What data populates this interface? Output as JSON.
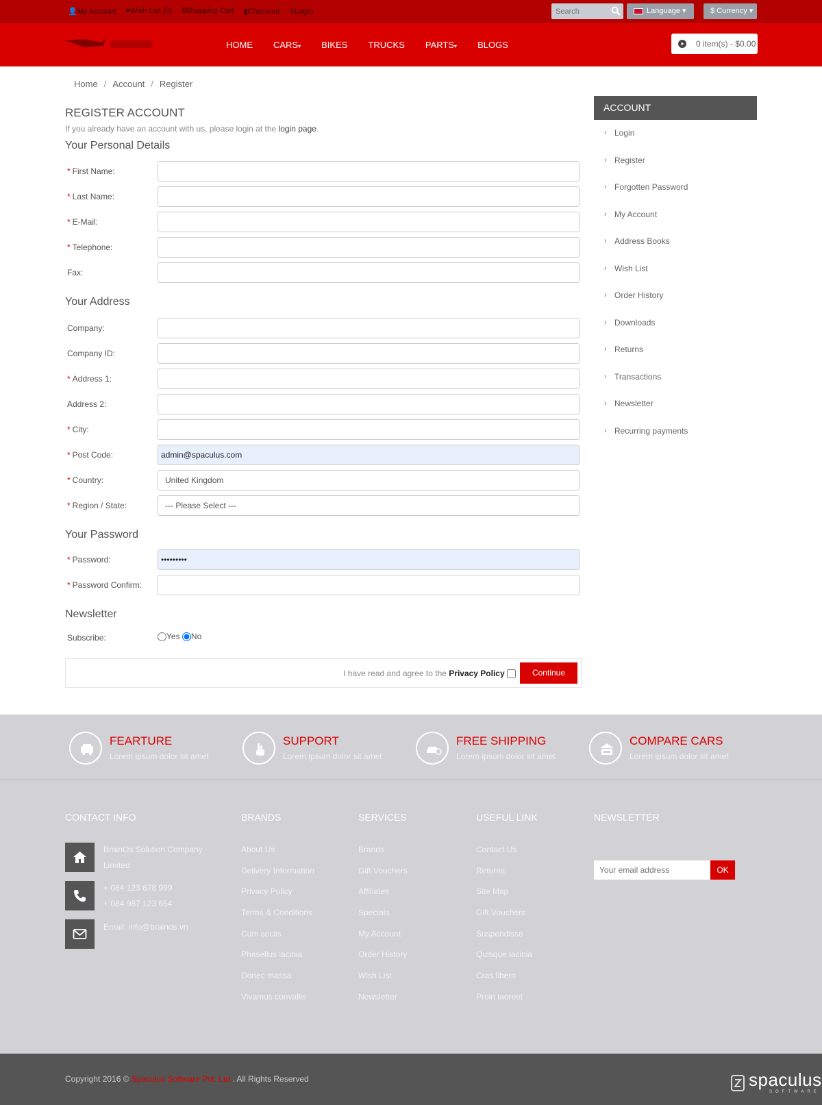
{
  "topbar": {
    "links": [
      "My Account",
      "Wish List (0)",
      "Shopping Cart",
      "Checkout",
      "Login"
    ],
    "search_placeholder": "Search",
    "language_label": "Language",
    "currency_label": "$ Currency"
  },
  "navbar": {
    "items": [
      "HOME",
      "CARS",
      "BIKES",
      "TRUCKS",
      "PARTS",
      "BLOGS"
    ],
    "cart_summary": "0 item(s) - $0.00"
  },
  "breadcrumb": [
    "Home",
    "Account",
    "Register"
  ],
  "page": {
    "title": "REGISTER ACCOUNT",
    "intro_text": "If you already have an account with us, please login at the",
    "intro_link": "login page",
    "intro_end": "."
  },
  "personal": {
    "heading": "Your Personal Details",
    "first_name": "First Name:",
    "last_name": "Last Name:",
    "email": "E-Mail:",
    "telephone": "Telephone:",
    "fax": "Fax:"
  },
  "address": {
    "heading": "Your Address",
    "company": "Company:",
    "company_id": "Company ID:",
    "address1": "Address 1:",
    "address2": "Address 2:",
    "city": "City:",
    "postcode": "Post Code:",
    "postcode_value": "admin@spaculus.com",
    "country": "Country:",
    "country_value": "United Kingdom",
    "region": "Region / State:",
    "region_value": "--- Please Select ---"
  },
  "password": {
    "heading": "Your Password",
    "password": "Password:",
    "password_value": "•••••••••",
    "confirm": "Password Confirm:"
  },
  "newsletter": {
    "heading": "Newsletter",
    "subscribe": "Subscribe:",
    "yes": "Yes",
    "no": "No",
    "selected": "No"
  },
  "agree": {
    "text": "I have read and agree to the",
    "link": "Privacy Policy",
    "button": "Continue"
  },
  "sidebar": {
    "heading": "ACCOUNT",
    "items": [
      "Login",
      "Register",
      "Forgotten Password",
      "My Account",
      "Address Books",
      "Wish List",
      "Order History",
      "Downloads",
      "Returns",
      "Transactions",
      "Newsletter",
      "Recurring payments"
    ]
  },
  "features": [
    {
      "title": "FEARTURE",
      "sub": "Lorem ipsum dolor sit amet"
    },
    {
      "title": "SUPPORT",
      "sub": "Lorem ipsum dolor sit amet"
    },
    {
      "title": "FREE SHIPPING",
      "sub": "Lorem ipsum dolor sit amet"
    },
    {
      "title": "COMPARE CARS",
      "sub": "Lorem ipsum dolor sit amet"
    }
  ],
  "footer": {
    "contact_heading": "CONTACT INFO",
    "address_line1": "BrainOs Solution Company",
    "address_line2": "Limited",
    "phone1": "+ 084 123 678 999",
    "phone2": "+ 084 987 123 654",
    "email": "Email: info@brainos.vn",
    "brands_heading": "BRANDS",
    "brands": [
      "About Us",
      "Delivery Information",
      "Privacy Policy",
      "Terms & Conditions",
      "Cum sociis",
      "Phasellus lacinia",
      "Donec massa",
      "Vivamus convallis"
    ],
    "services_heading": "SERVICES",
    "services": [
      "Brands",
      "Gift Vouchers",
      "Affiliates",
      "Specials",
      "My Account",
      "Order History",
      "Wish List",
      "Newsletter"
    ],
    "useful_heading": "USEFUL LINK",
    "useful": [
      "Contact Us",
      "Returns",
      "Site Map",
      "Gift Vouchers",
      "Suspendisse",
      "Quisque lacinia",
      "Cras libero",
      "Proin laoreet"
    ],
    "newsletter_heading": "NEWSLETTER",
    "newsletter_placeholder": "Your email address",
    "newsletter_button": "OK"
  },
  "bottom": {
    "copyright_prefix": "Copyright 2016 ©",
    "company": "Spaculus Software Pvt. Ltd.",
    "rights": ". All Rights Reserved",
    "brand_name": "spaculus",
    "brand_sub": "SOFTWARE"
  },
  "colors": {
    "primary_red": "#d90000",
    "dark_red": "#b30000",
    "footer_gray": "#d1d1d6",
    "bottom_gray": "#555555"
  }
}
